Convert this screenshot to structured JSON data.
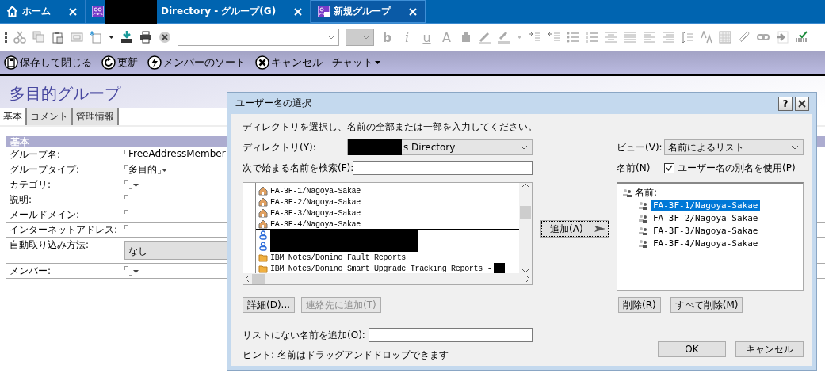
{
  "tabs": [
    {
      "label": "ホーム",
      "kind": "home",
      "selected": false,
      "redacted": false
    },
    {
      "label": "Directory - グループ(G)",
      "kind": "group",
      "selected": false,
      "redacted": true
    },
    {
      "label": "新規グループ",
      "kind": "new_group",
      "selected": true,
      "redacted": false
    }
  ],
  "format_glyphs": [
    "b",
    "i",
    "u",
    "A"
  ],
  "actions": [
    {
      "label": "保存して閉じる",
      "kind": "save"
    },
    {
      "label": "更新",
      "kind": "refresh"
    },
    {
      "label": "メンバーのソート",
      "kind": "sort"
    },
    {
      "label": "キャンセル",
      "kind": "cancel"
    },
    {
      "label": "チャット",
      "kind": "menu"
    }
  ],
  "form": {
    "title": "多目的グループ",
    "tabs": [
      {
        "label": "基本",
        "selected": true
      },
      {
        "label": "コメント",
        "selected": false
      },
      {
        "label": "管理情報",
        "selected": false
      }
    ],
    "section": "基本",
    "fields": [
      {
        "label": "グループ名:",
        "kind": "text",
        "value": "FreeAddressMember"
      },
      {
        "label": "グループタイプ:",
        "kind": "dropdown",
        "value": "多目的"
      },
      {
        "label": "カテゴリ:",
        "kind": "dropdown"
      },
      {
        "label": "説明:",
        "kind": "text"
      },
      {
        "label": "メールドメイン:",
        "kind": "text"
      },
      {
        "label": "インターネットアドレス:",
        "kind": "text"
      },
      {
        "label": "自動取り込み方法:",
        "kind": "select",
        "value": "なし"
      },
      {
        "label": "メンバー:",
        "kind": "dropdown"
      }
    ]
  },
  "dialog": {
    "title": "ユーザー名の選択",
    "help": "?",
    "instruction": "ディレクトリを選択し、名前の全部または一部を入力してください。",
    "directory": {
      "label": "ディレクトリ(Y):",
      "value": "s Directory",
      "redacted": true
    },
    "search": {
      "label": "次で始まる名前を検索(F):"
    },
    "entries": [
      {
        "kind": "resource",
        "text": "FA-3F-1/Nagoya-Sakae",
        "focused": false,
        "redacted": false
      },
      {
        "kind": "resource",
        "text": "FA-3F-2/Nagoya-Sakae",
        "focused": false,
        "redacted": false
      },
      {
        "kind": "resource",
        "text": "FA-3F-3/Nagoya-Sakae",
        "focused": false,
        "redacted": false
      },
      {
        "kind": "resource",
        "text": "FA-3F-4/Nagoya-Sakae",
        "focused": true,
        "redacted": false
      },
      {
        "kind": "person",
        "focused": false,
        "redacted": true
      },
      {
        "kind": "person",
        "focused": false,
        "redacted": true
      },
      {
        "kind": "folder",
        "text": "IBM Notes/Domino Fault Reports",
        "focused": false,
        "redacted": false
      },
      {
        "kind": "folder",
        "text": "IBM Notes/Domino Smart Upgrade Tracking Reports -",
        "focused": false,
        "redacted": true
      }
    ],
    "details_button": {
      "label": "詳細(D)...",
      "disabled": false
    },
    "add_contact_button": {
      "label": "連絡先に追加(T)",
      "disabled": true
    },
    "add_button": "追加(A)",
    "view": {
      "label": "ビュー(V):",
      "value": "名前によるリスト"
    },
    "names_label": "名前(N)",
    "alias_checkbox": {
      "label": "ユーザー名の別名を使用(P)",
      "checked": true
    },
    "selected_names": {
      "label": "名前:",
      "children": [
        {
          "label": "FA-3F-1/Nagoya-Sakae",
          "selected": true
        },
        {
          "label": "FA-3F-2/Nagoya-Sakae",
          "selected": false
        },
        {
          "label": "FA-3F-3/Nagoya-Sakae",
          "selected": false
        },
        {
          "label": "FA-3F-4/Nagoya-Sakae",
          "selected": false
        }
      ]
    },
    "remove_button": "削除(R)",
    "remove_all_button": "すべて削除(M)",
    "unlisted": {
      "label": "リストにない名前を追加(O):"
    },
    "hint": "ヒント: 名前はドラッグアンドドロップできます",
    "ok_button": "OK",
    "cancel_button": "キャンセル"
  }
}
